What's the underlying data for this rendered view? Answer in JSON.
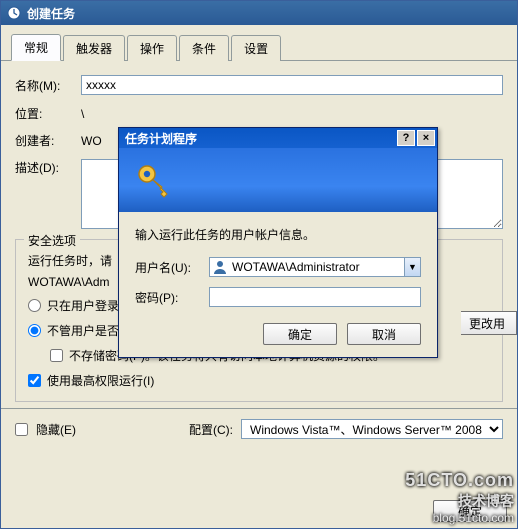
{
  "window": {
    "title": "创建任务"
  },
  "tabs": [
    {
      "label": "常规",
      "active": true
    },
    {
      "label": "触发器",
      "active": false
    },
    {
      "label": "操作",
      "active": false
    },
    {
      "label": "条件",
      "active": false
    },
    {
      "label": "设置",
      "active": false
    }
  ],
  "general": {
    "name_label": "名称(M):",
    "name_value": "xxxxx",
    "location_label": "位置:",
    "location_value": "\\",
    "author_label": "创建者:",
    "author_value": "WO",
    "desc_label": "描述(D):"
  },
  "security": {
    "legend": "安全选项",
    "run_as_line": "运行任务时，请",
    "account_text": "WOTAWA\\Adm",
    "change_user_btn": "更改用",
    "radio_logged_on": "只在用户登录",
    "radio_whether": "不管用户是否",
    "dont_store_pwd": "不存储密码(P)。该任务将只有访问本地计算机资源的权限。",
    "run_highest": "使用最高权限运行(I)"
  },
  "bottom": {
    "hidden": "隐藏(E)",
    "configure_label": "配置(C):",
    "configure_value": "Windows Vista™、Windows Server™ 2008",
    "ok": "确定"
  },
  "dialog": {
    "title": "任务计划程序",
    "prompt": "输入运行此任务的用户帐户信息。",
    "user_label": "用户名(U):",
    "user_value": "WOTAWA\\Administrator",
    "password_label": "密码(P):",
    "ok": "确定",
    "cancel": "取消",
    "help_btn": "?",
    "close_btn": "×"
  },
  "watermark": {
    "line1": "51CTO.com",
    "line2": "技术博客",
    "line3": "blog.51cto.com"
  }
}
